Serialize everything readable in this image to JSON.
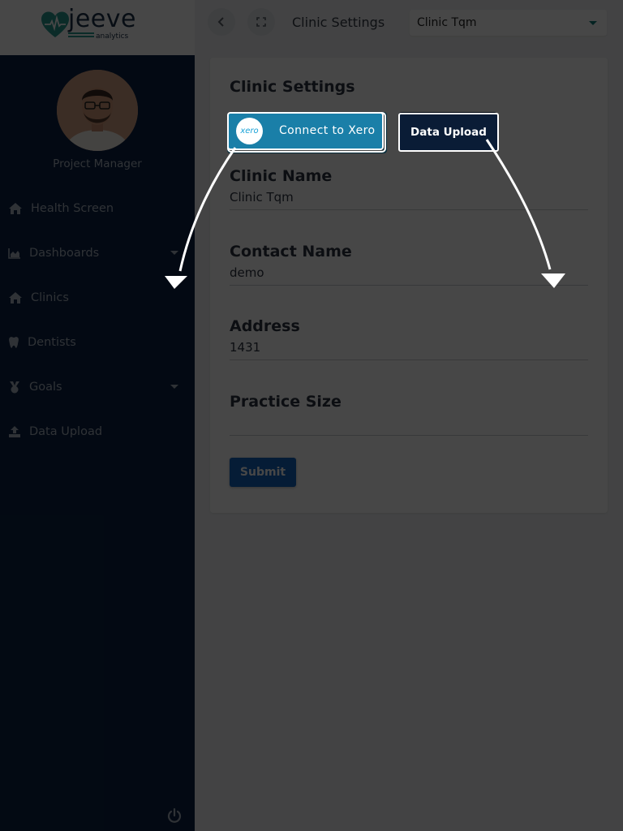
{
  "brand": {
    "name": "jeeve",
    "tagline": "analytics",
    "heart_color": "#2a9a91",
    "text_color": "#1c3048"
  },
  "sidebar": {
    "background": "#0c2344",
    "role": "Project Manager",
    "items": [
      {
        "label": "Health Screen",
        "icon": "home-icon",
        "has_caret": false
      },
      {
        "label": "Dashboards",
        "icon": "chart-area-icon",
        "has_caret": true
      },
      {
        "label": "Clinics",
        "icon": "home-icon",
        "has_caret": false
      },
      {
        "label": "Dentists",
        "icon": "tooth-icon",
        "has_caret": false
      },
      {
        "label": "Goals",
        "icon": "medal-icon",
        "has_caret": true
      },
      {
        "label": "Data Upload",
        "icon": "upload-icon",
        "has_caret": false
      }
    ],
    "footer_icon": "power-icon"
  },
  "topbar": {
    "back_icon": "chevron-left-icon",
    "fullscreen_icon": "fullscreen-icon",
    "title": "Clinic Settings",
    "clinic_select": {
      "value": "Clinic Tqm"
    }
  },
  "card": {
    "title": "Clinic Settings",
    "xero_button": {
      "logo_text": "xero",
      "label": "Connect to Xero",
      "color": "#1aa3d8"
    },
    "upload_button": {
      "label": "Data Upload"
    },
    "fields": {
      "clinic_name": {
        "label": "Clinic Name",
        "value": "Clinic Tqm"
      },
      "contact_name": {
        "label": "Contact Name",
        "value": "demo"
      },
      "address": {
        "label": "Address",
        "value": "1431"
      },
      "practice_size": {
        "label": "Practice Size",
        "value": ""
      }
    },
    "submit_label": "Submit",
    "submit_color": "#1565c0"
  },
  "overlay": {
    "dim_opacity": 0.72,
    "arrow_color": "#ffffff"
  }
}
